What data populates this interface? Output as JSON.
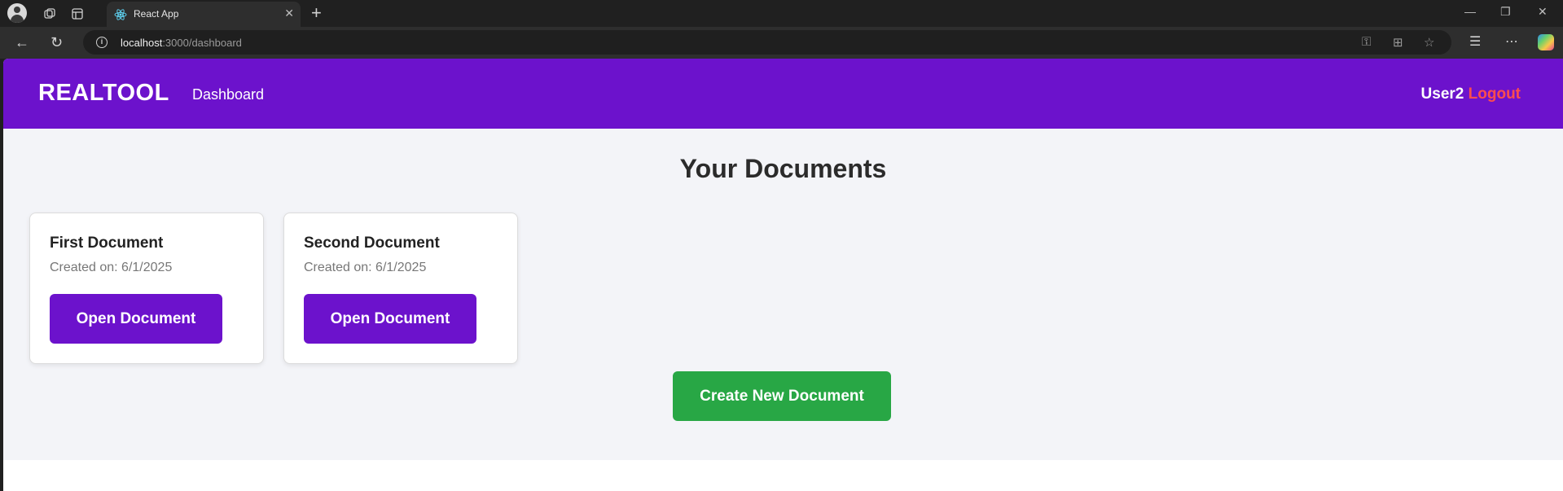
{
  "browser": {
    "tab_title": "React App",
    "url_host": "localhost",
    "url_rest": ":3000/dashboard"
  },
  "app": {
    "brand": "REALTOOL",
    "nav_dashboard": "Dashboard",
    "user_name": "User2",
    "logout_label": "Logout"
  },
  "main": {
    "heading": "Your Documents",
    "documents": [
      {
        "title": "First Document",
        "created": "Created on: 6/1/2025",
        "open_label": "Open Document"
      },
      {
        "title": "Second Document",
        "created": "Created on: 6/1/2025",
        "open_label": "Open Document"
      }
    ],
    "create_label": "Create New Document"
  },
  "colors": {
    "header": "#6c12cc",
    "primary_button": "#6c12cc",
    "create_button": "#28a745",
    "logout": "#ff4d4d",
    "page_bg": "#f3f4f8"
  }
}
